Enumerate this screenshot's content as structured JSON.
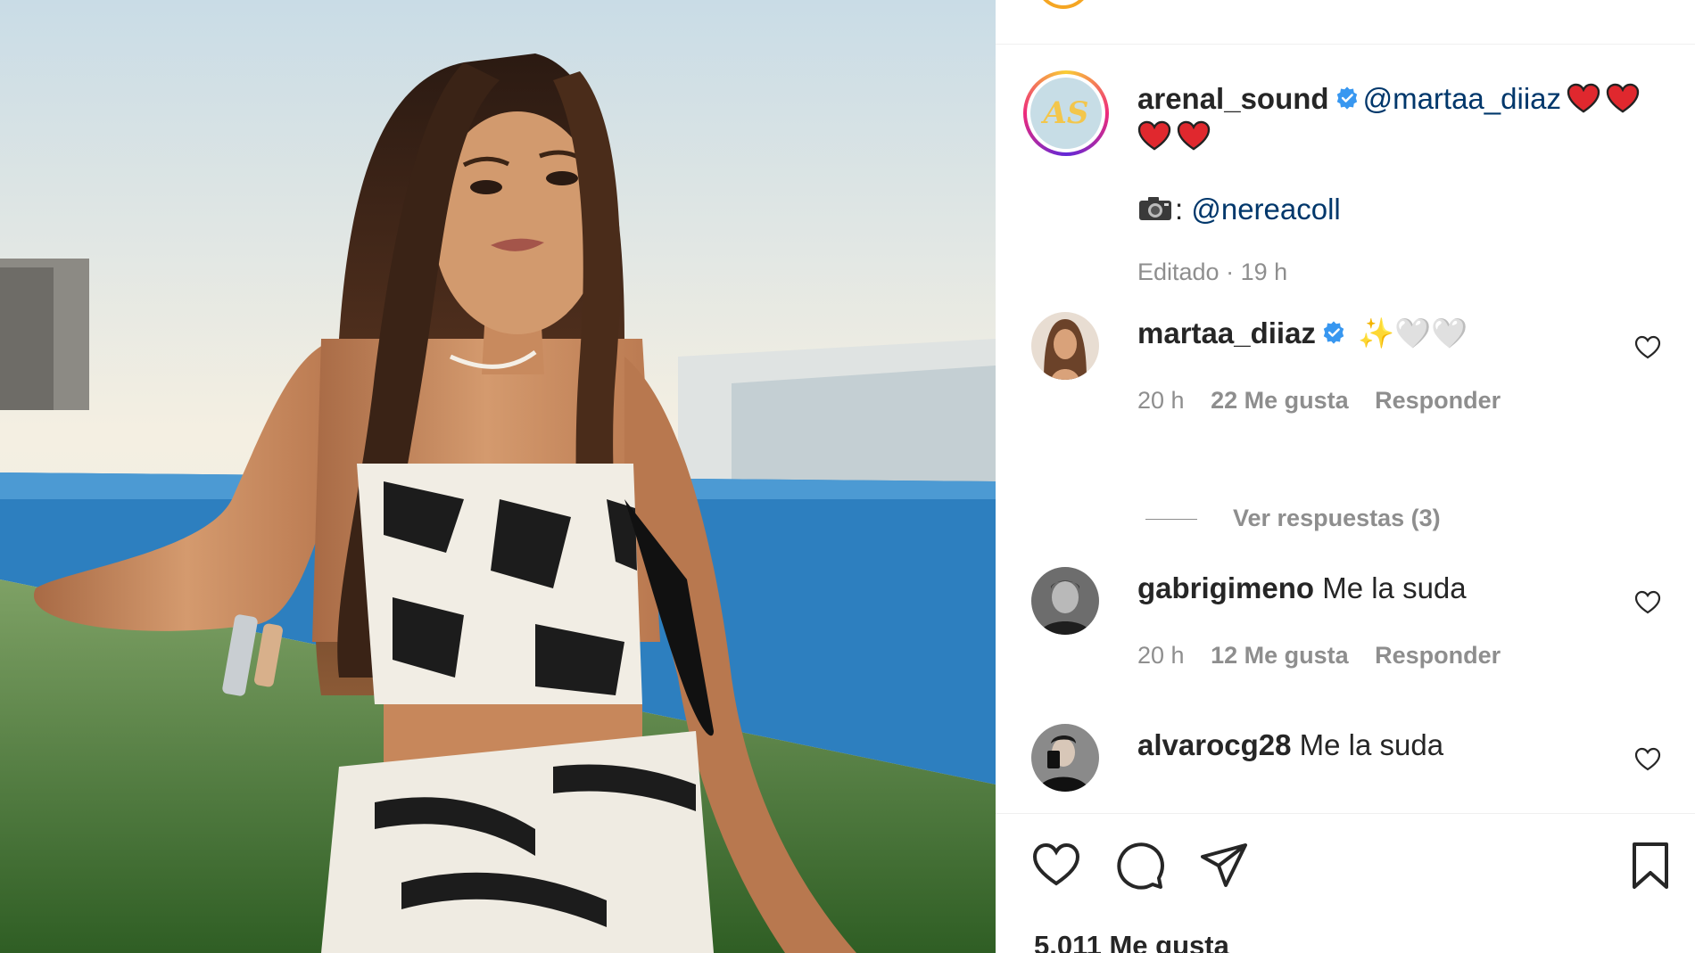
{
  "post": {
    "author": "arenal_sound",
    "avatar_text": "AS",
    "caption_mention": "@martaa_diiaz",
    "photo_credit_sep": ":",
    "photo_credit": "@nereacoll",
    "edited_label": "Editado · 19 h",
    "likes": "5.011 Me gusta"
  },
  "comments": [
    {
      "username": "martaa_diiaz",
      "verified": true,
      "text": "✨🤍🤍",
      "time": "20 h",
      "likes": "22 Me gusta",
      "reply": "Responder",
      "view_replies": "Ver respuestas (3)"
    },
    {
      "username": "gabrigimeno",
      "verified": false,
      "text": "Me la suda",
      "time": "20 h",
      "likes": "12 Me gusta",
      "reply": "Responder"
    },
    {
      "username": "alvarocg28",
      "verified": false,
      "text": "Me la suda"
    }
  ],
  "icons": {
    "verified": "verified-badge-icon",
    "like": "heart-icon",
    "comment": "comment-icon",
    "share": "paper-plane-icon",
    "save": "bookmark-icon"
  },
  "colors": {
    "mention": "#00376b",
    "verified": "#3897f0",
    "muted": "#8e8e8e",
    "text": "#262626"
  }
}
